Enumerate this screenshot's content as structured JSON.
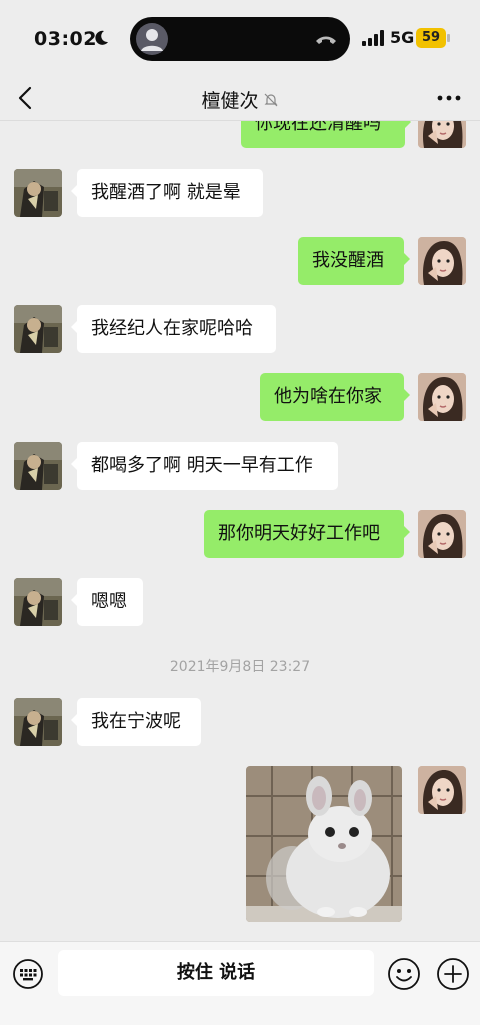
{
  "status": {
    "time": "03:02",
    "network": "5G",
    "battery": "59",
    "icons": [
      "moon-icon",
      "signal-icon",
      "phone-icon"
    ]
  },
  "header": {
    "title": "檀健次",
    "icons": [
      "back-chevron-icon",
      "mute-bell-icon",
      "more-icon"
    ]
  },
  "messages": [
    {
      "side": "out",
      "text": "你现在还清醒吗"
    },
    {
      "side": "in",
      "text": "我醒酒了啊 就是晕"
    },
    {
      "side": "out",
      "text": "我没醒酒"
    },
    {
      "side": "in",
      "text": "我经纪人在家呢哈哈"
    },
    {
      "side": "out",
      "text": "他为啥在你家"
    },
    {
      "side": "in",
      "text": "都喝多了啊 明天一早有工作"
    },
    {
      "side": "out",
      "text": "那你明天好好工作吧"
    },
    {
      "side": "in",
      "text": "嗯嗯"
    },
    {
      "side": "in",
      "text": "我在宁波呢"
    }
  ],
  "timestamp": "2021年9月8日 23:27",
  "image_message": {
    "side": "out",
    "icon": "chinchilla-photo"
  },
  "input": {
    "hold_to_talk": "按住 说话",
    "icons": [
      "keyboard-icon",
      "emoji-icon",
      "plus-icon"
    ]
  },
  "colors": {
    "background": "#ededed",
    "outgoing_bubble": "#95ec69",
    "incoming_bubble": "#ffffff",
    "battery": "#f2c100"
  }
}
